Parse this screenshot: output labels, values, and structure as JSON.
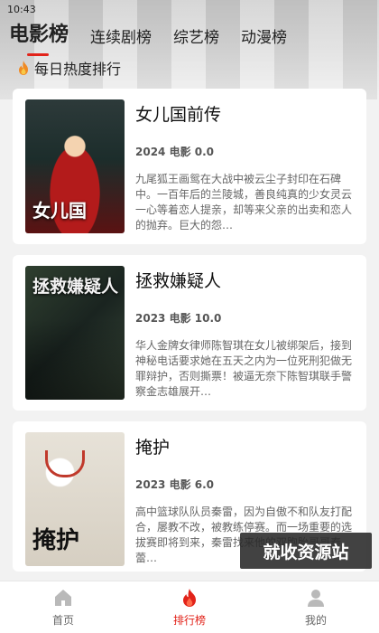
{
  "status": {
    "time": "10:43"
  },
  "tabs": [
    {
      "label": "电影榜",
      "active": true
    },
    {
      "label": "连续剧榜",
      "active": false
    },
    {
      "label": "综艺榜",
      "active": false
    },
    {
      "label": "动漫榜",
      "active": false
    }
  ],
  "section": {
    "title": "每日热度排行",
    "icon": "flame-icon"
  },
  "items": [
    {
      "title": "女儿国前传",
      "meta": "2024 电影 0.0",
      "description": "九尾狐王画鸳在大战中被云尘子封印在石碑中。一百年后的兰陵城，善良纯真的少女灵云一心等着恋人提亲，却等来父亲的出卖和恋人的抛弃。巨大的怨…",
      "poster_text": "女儿国"
    },
    {
      "title": "拯救嫌疑人",
      "meta": "2023 电影 10.0",
      "description": "华人金牌女律师陈智琪在女儿被绑架后，接到神秘电话要求她在五天之内为一位死刑犯做无罪辩护，否则撕票！被逼无奈下陈智琪联手警察金志雄展开…",
      "poster_text": "拯救嫌疑人"
    },
    {
      "title": "掩护",
      "meta": "2023 电影 6.0",
      "description": "高中篮球队队员秦雷，因为自傲不和队友打配合，屡教不改，被教练停赛。而一场重要的选拔赛即将到来，秦雷找来他的双胞胎哥哥秦蕾…",
      "poster_text": "掩护"
    }
  ],
  "watermark": "就收资源站",
  "nav": [
    {
      "label": "首页",
      "icon": "home-icon",
      "active": false
    },
    {
      "label": "排行榜",
      "icon": "flame-icon",
      "active": true
    },
    {
      "label": "我的",
      "icon": "user-icon",
      "active": false
    }
  ],
  "colors": {
    "accent": "#e2231a",
    "background": "#f2f2f2",
    "card": "#ffffff"
  }
}
